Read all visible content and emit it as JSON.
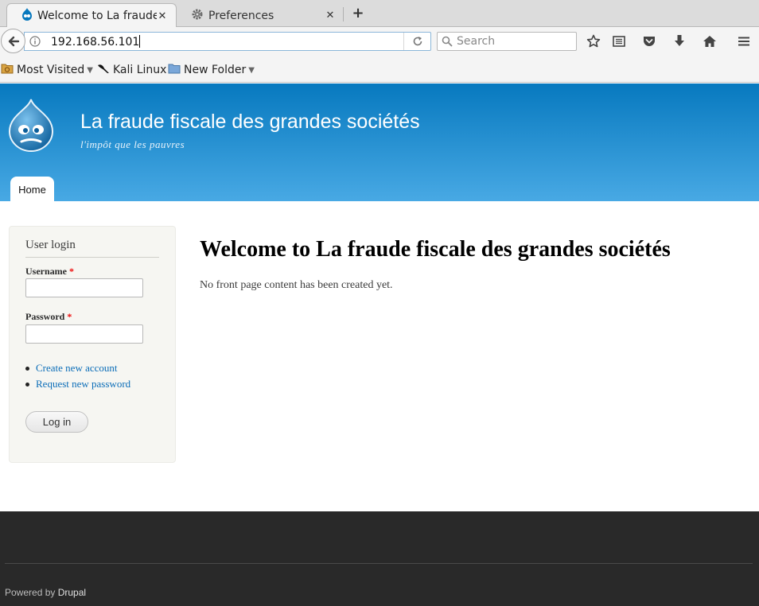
{
  "browser": {
    "tabs": [
      {
        "title": "Welcome to La fraude...",
        "active": true
      },
      {
        "title": "Preferences",
        "active": false
      }
    ],
    "url": "192.168.56.101",
    "search_placeholder": "Search",
    "bookmarks": [
      {
        "label": "Most Visited",
        "has_dropdown": true,
        "icon": "folder-most-visited-icon"
      },
      {
        "label": "Kali Linux",
        "has_dropdown": false,
        "icon": "kali-dragon-icon"
      },
      {
        "label": "New Folder",
        "has_dropdown": true,
        "icon": "folder-icon"
      }
    ],
    "toolbar_icons": [
      "star-icon",
      "reading-list-icon",
      "pocket-icon",
      "download-icon",
      "home-icon",
      "menu-icon"
    ]
  },
  "header": {
    "site_name": "La fraude fiscale des grandes sociétés",
    "slogan": "l'impôt que les pauvres",
    "nav_home": "Home",
    "gradient_top": "#0779bf",
    "gradient_bottom": "#48a9e4"
  },
  "sidebar": {
    "title": "User login",
    "username_label": "Username",
    "password_label": "Password",
    "required_marker": "*",
    "links": [
      "Create new account",
      "Request new password"
    ],
    "login_button": "Log in"
  },
  "main": {
    "title": "Welcome to La fraude fiscale des grandes sociétés",
    "text": "No front page content has been created yet."
  },
  "footer": {
    "powered_prefix": "Powered by",
    "powered_link": "Drupal",
    "background": "#292929"
  }
}
